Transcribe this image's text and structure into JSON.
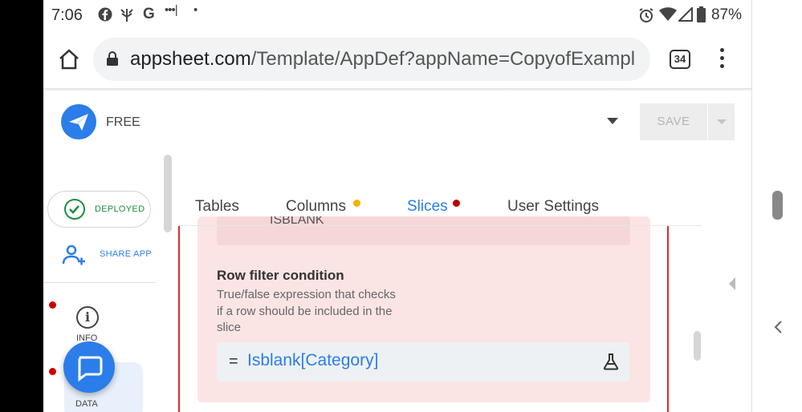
{
  "status_bar": {
    "time": "7:06",
    "left_icons": [
      "facebook-icon",
      "pinwheel-icon",
      "google-icon",
      "signal-dots-icon",
      "dot-icon"
    ],
    "right_icons": [
      "alarm-icon",
      "wifi-icon",
      "cell-signal-icon",
      "battery-icon"
    ],
    "battery": "87%"
  },
  "browser": {
    "url_domain": "appsheet.com",
    "url_path": "/Template/AppDef?appName=CopyofExampl",
    "tab_count": "34"
  },
  "app_header": {
    "plan": "FREE",
    "save_label": "SAVE"
  },
  "left_nav": {
    "deployed_label": "DEPLOYED",
    "share_label": "SHARE APP",
    "info_label": "INFO",
    "data_label": "DATA"
  },
  "tabs": [
    {
      "label": "Tables",
      "dot": null
    },
    {
      "label": "Columns",
      "dot": "#f4b400"
    },
    {
      "label": "Slices",
      "dot": "#c00000",
      "active": true
    },
    {
      "label": "User Settings",
      "dot": null
    }
  ],
  "editor": {
    "previous_field_value": "ISBLANK",
    "row_filter_title": "Row filter condition",
    "row_filter_description_lines": [
      "True/false expression that checks",
      "if a row should be included in the",
      "slice"
    ],
    "expression_prefix": "=",
    "expression_value": "Isblank[Category]"
  },
  "colors": {
    "accent": "#2b7de9",
    "error": "#d32f2f",
    "deployed_green": "#1e8e3e",
    "warning_dot": "#f4b400",
    "card_background": "#fbe4e4"
  }
}
